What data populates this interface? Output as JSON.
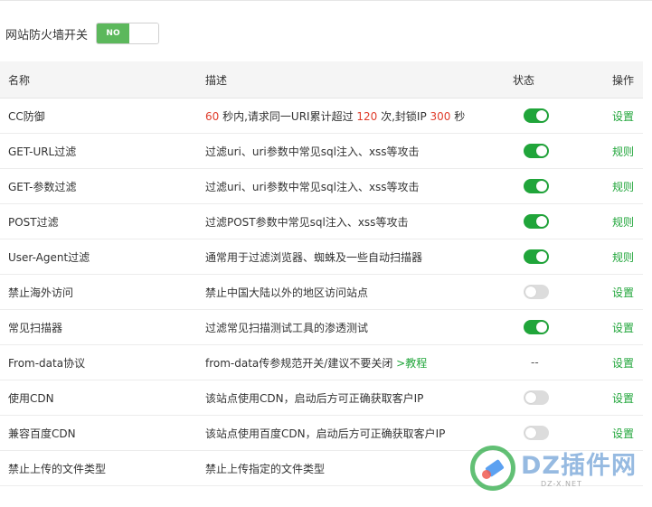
{
  "firewall": {
    "label": "网站防火墙开关",
    "toggle_text": "NO"
  },
  "table": {
    "headers": [
      "名称",
      "描述",
      "状态",
      "操作"
    ],
    "rows": [
      {
        "name": "CC防御",
        "desc": [
          "60",
          " 秒内,请求同一URI累计超过 ",
          "120",
          " 次,封锁IP ",
          "300",
          " 秒"
        ],
        "status": "on",
        "action": "设置"
      },
      {
        "name": "GET-URL过滤",
        "desc": "过滤uri、uri参数中常见sql注入、xss等攻击",
        "status": "on",
        "action": "规则"
      },
      {
        "name": "GET-参数过滤",
        "desc": "过滤uri、uri参数中常见sql注入、xss等攻击",
        "status": "on",
        "action": "规则"
      },
      {
        "name": "POST过滤",
        "desc": "过滤POST参数中常见sql注入、xss等攻击",
        "status": "on",
        "action": "规则"
      },
      {
        "name": "User-Agent过滤",
        "desc": "通常用于过滤浏览器、蜘蛛及一些自动扫描器",
        "status": "on",
        "action": "规则"
      },
      {
        "name": "禁止海外访问",
        "desc": "禁止中国大陆以外的地区访问站点",
        "status": "off",
        "action": "设置"
      },
      {
        "name": "常见扫描器",
        "desc": "过滤常见扫描测试工具的渗透测试",
        "status": "on",
        "action": "设置"
      },
      {
        "name": "From-data协议",
        "desc": "from-data传参规范开关/建议不要关闭",
        "desc_link": ">教程",
        "status_text": "--",
        "action": "设置"
      },
      {
        "name": "使用CDN",
        "desc": "该站点使用CDN，启动后方可正确获取客户IP",
        "status": "off",
        "action": "设置"
      },
      {
        "name": "兼容百度CDN",
        "desc": "该站点使用百度CDN，启动后方可正确获取客户IP",
        "status": "off",
        "action": "设置"
      },
      {
        "name": "禁止上传的文件类型",
        "desc": "禁止上传指定的文件类型",
        "status": "",
        "action": ""
      }
    ]
  },
  "watermark": {
    "text": "DZ插件网",
    "sub": "DZ-X.NET"
  },
  "colors": {
    "accent_green": "#20a53a",
    "danger_red": "#e03e2d",
    "switch_off": "#dcdcdc"
  }
}
